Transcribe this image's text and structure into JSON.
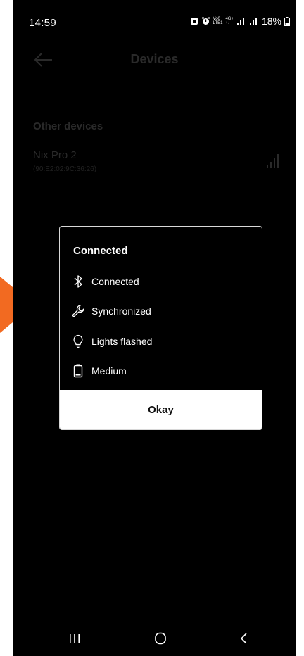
{
  "status_bar": {
    "time": "14:59",
    "network_top": "Vo0",
    "network_bottom": "LTE1",
    "network_gen": "4G+",
    "battery": "18%"
  },
  "header": {
    "title": "Devices",
    "back_icon": "arrow-left-icon"
  },
  "devices": {
    "section_title": "Other devices",
    "items": [
      {
        "name": "Nix Pro 2",
        "address": "(90:E2:02:9C:36:26)",
        "signal_icon": "signal-bars-icon"
      }
    ]
  },
  "dialog": {
    "title": "Connected",
    "rows": [
      {
        "icon": "bluetooth-icon",
        "label": "Connected"
      },
      {
        "icon": "wrench-icon",
        "label": "Synchronized"
      },
      {
        "icon": "lightbulb-icon",
        "label": "Lights flashed"
      },
      {
        "icon": "battery-icon",
        "label": "Medium"
      }
    ],
    "button_label": "Okay"
  },
  "nav": {
    "recents_icon": "recents-icon",
    "home_icon": "home-icon",
    "back_icon": "back-chevron-icon"
  },
  "colors": {
    "background": "#000000",
    "dialog_border": "#d8d8d8",
    "button_bg": "#ffffff",
    "pointer": "#f26a21",
    "dimmed_text": "#2a2a2a"
  }
}
